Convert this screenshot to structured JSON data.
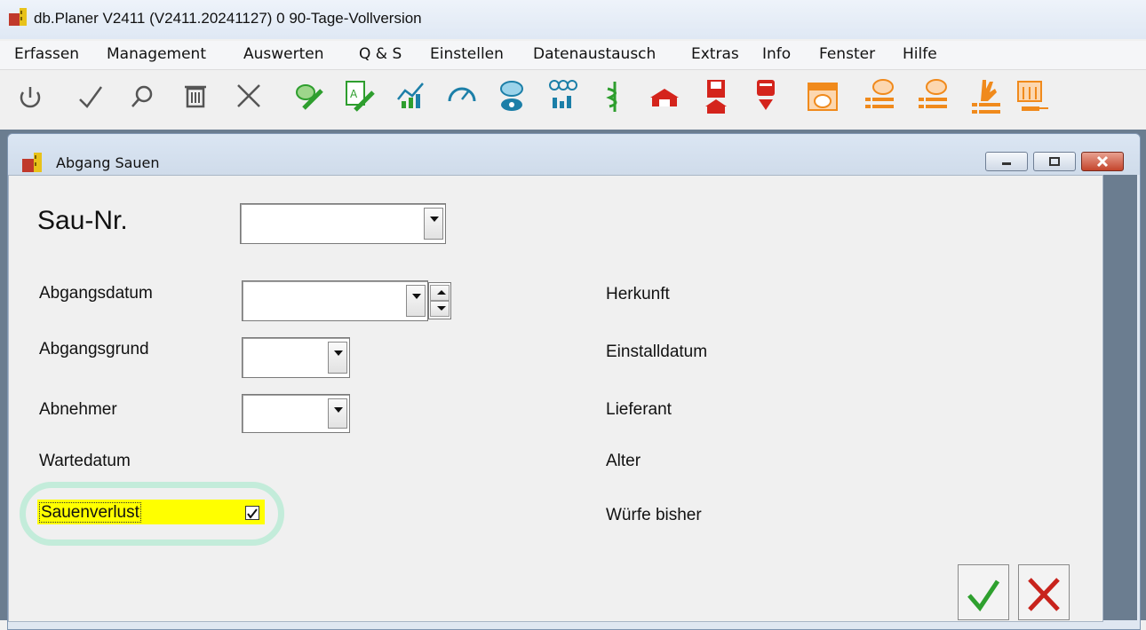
{
  "app": {
    "title": "db.Planer V2411 (V2411.20241127) 0 90-Tage-Vollversion"
  },
  "menu": [
    {
      "label": "Erfassen"
    },
    {
      "label": "Management"
    },
    {
      "label": "Auswerten"
    },
    {
      "label": "Q & S"
    },
    {
      "label": "Einstellen"
    },
    {
      "label": "Datenaustausch"
    },
    {
      "label": "Extras"
    },
    {
      "label": "Info"
    },
    {
      "label": "Fenster"
    },
    {
      "label": "Hilfe"
    }
  ],
  "toolbar": {
    "icons": [
      "power-icon",
      "check-icon",
      "search-icon",
      "trash-icon",
      "close-icon",
      "pig-edit-icon",
      "document-edit-icon",
      "chart-icon",
      "gauge-icon",
      "pig-eye-icon",
      "pig-stats-icon",
      "medical-icon",
      "barn-icon",
      "barn-save-icon",
      "download-icon",
      "pig-calendar-icon",
      "pig-list-icon",
      "pig-list-alt-icon",
      "hand-list-icon",
      "syringe-calendar-icon"
    ],
    "colors": {
      "gray": "#555555",
      "green": "#2e9e2e",
      "teal": "#1c7fa8",
      "orange": "#f08a1c",
      "red": "#d4241c"
    }
  },
  "window": {
    "title": "Abgang Sauen",
    "accent": "#ffff00"
  },
  "form": {
    "sau_nr_label": "Sau-Nr.",
    "sau_nr_value": "",
    "abgangsdatum_label": "Abgangsdatum",
    "abgangsdatum_value": "",
    "abgangsgrund_label": "Abgangsgrund",
    "abgangsgrund_value": "",
    "abnehmer_label": "Abnehmer",
    "abnehmer_value": "",
    "wartedatum_label": "Wartedatum",
    "sauenverlust_label": "Sauenverlust",
    "sauenverlust_checked": true
  },
  "info": {
    "herkunft_label": "Herkunft",
    "einstalldatum_label": "Einstalldatum",
    "lieferant_label": "Lieferant",
    "alter_label": "Alter",
    "wuerfe_label": "Würfe bisher"
  },
  "actions": {
    "ok_icon": "check-icon",
    "cancel_icon": "cross-icon",
    "ok_color": "#2ea02e",
    "cancel_color": "#c8231c"
  }
}
